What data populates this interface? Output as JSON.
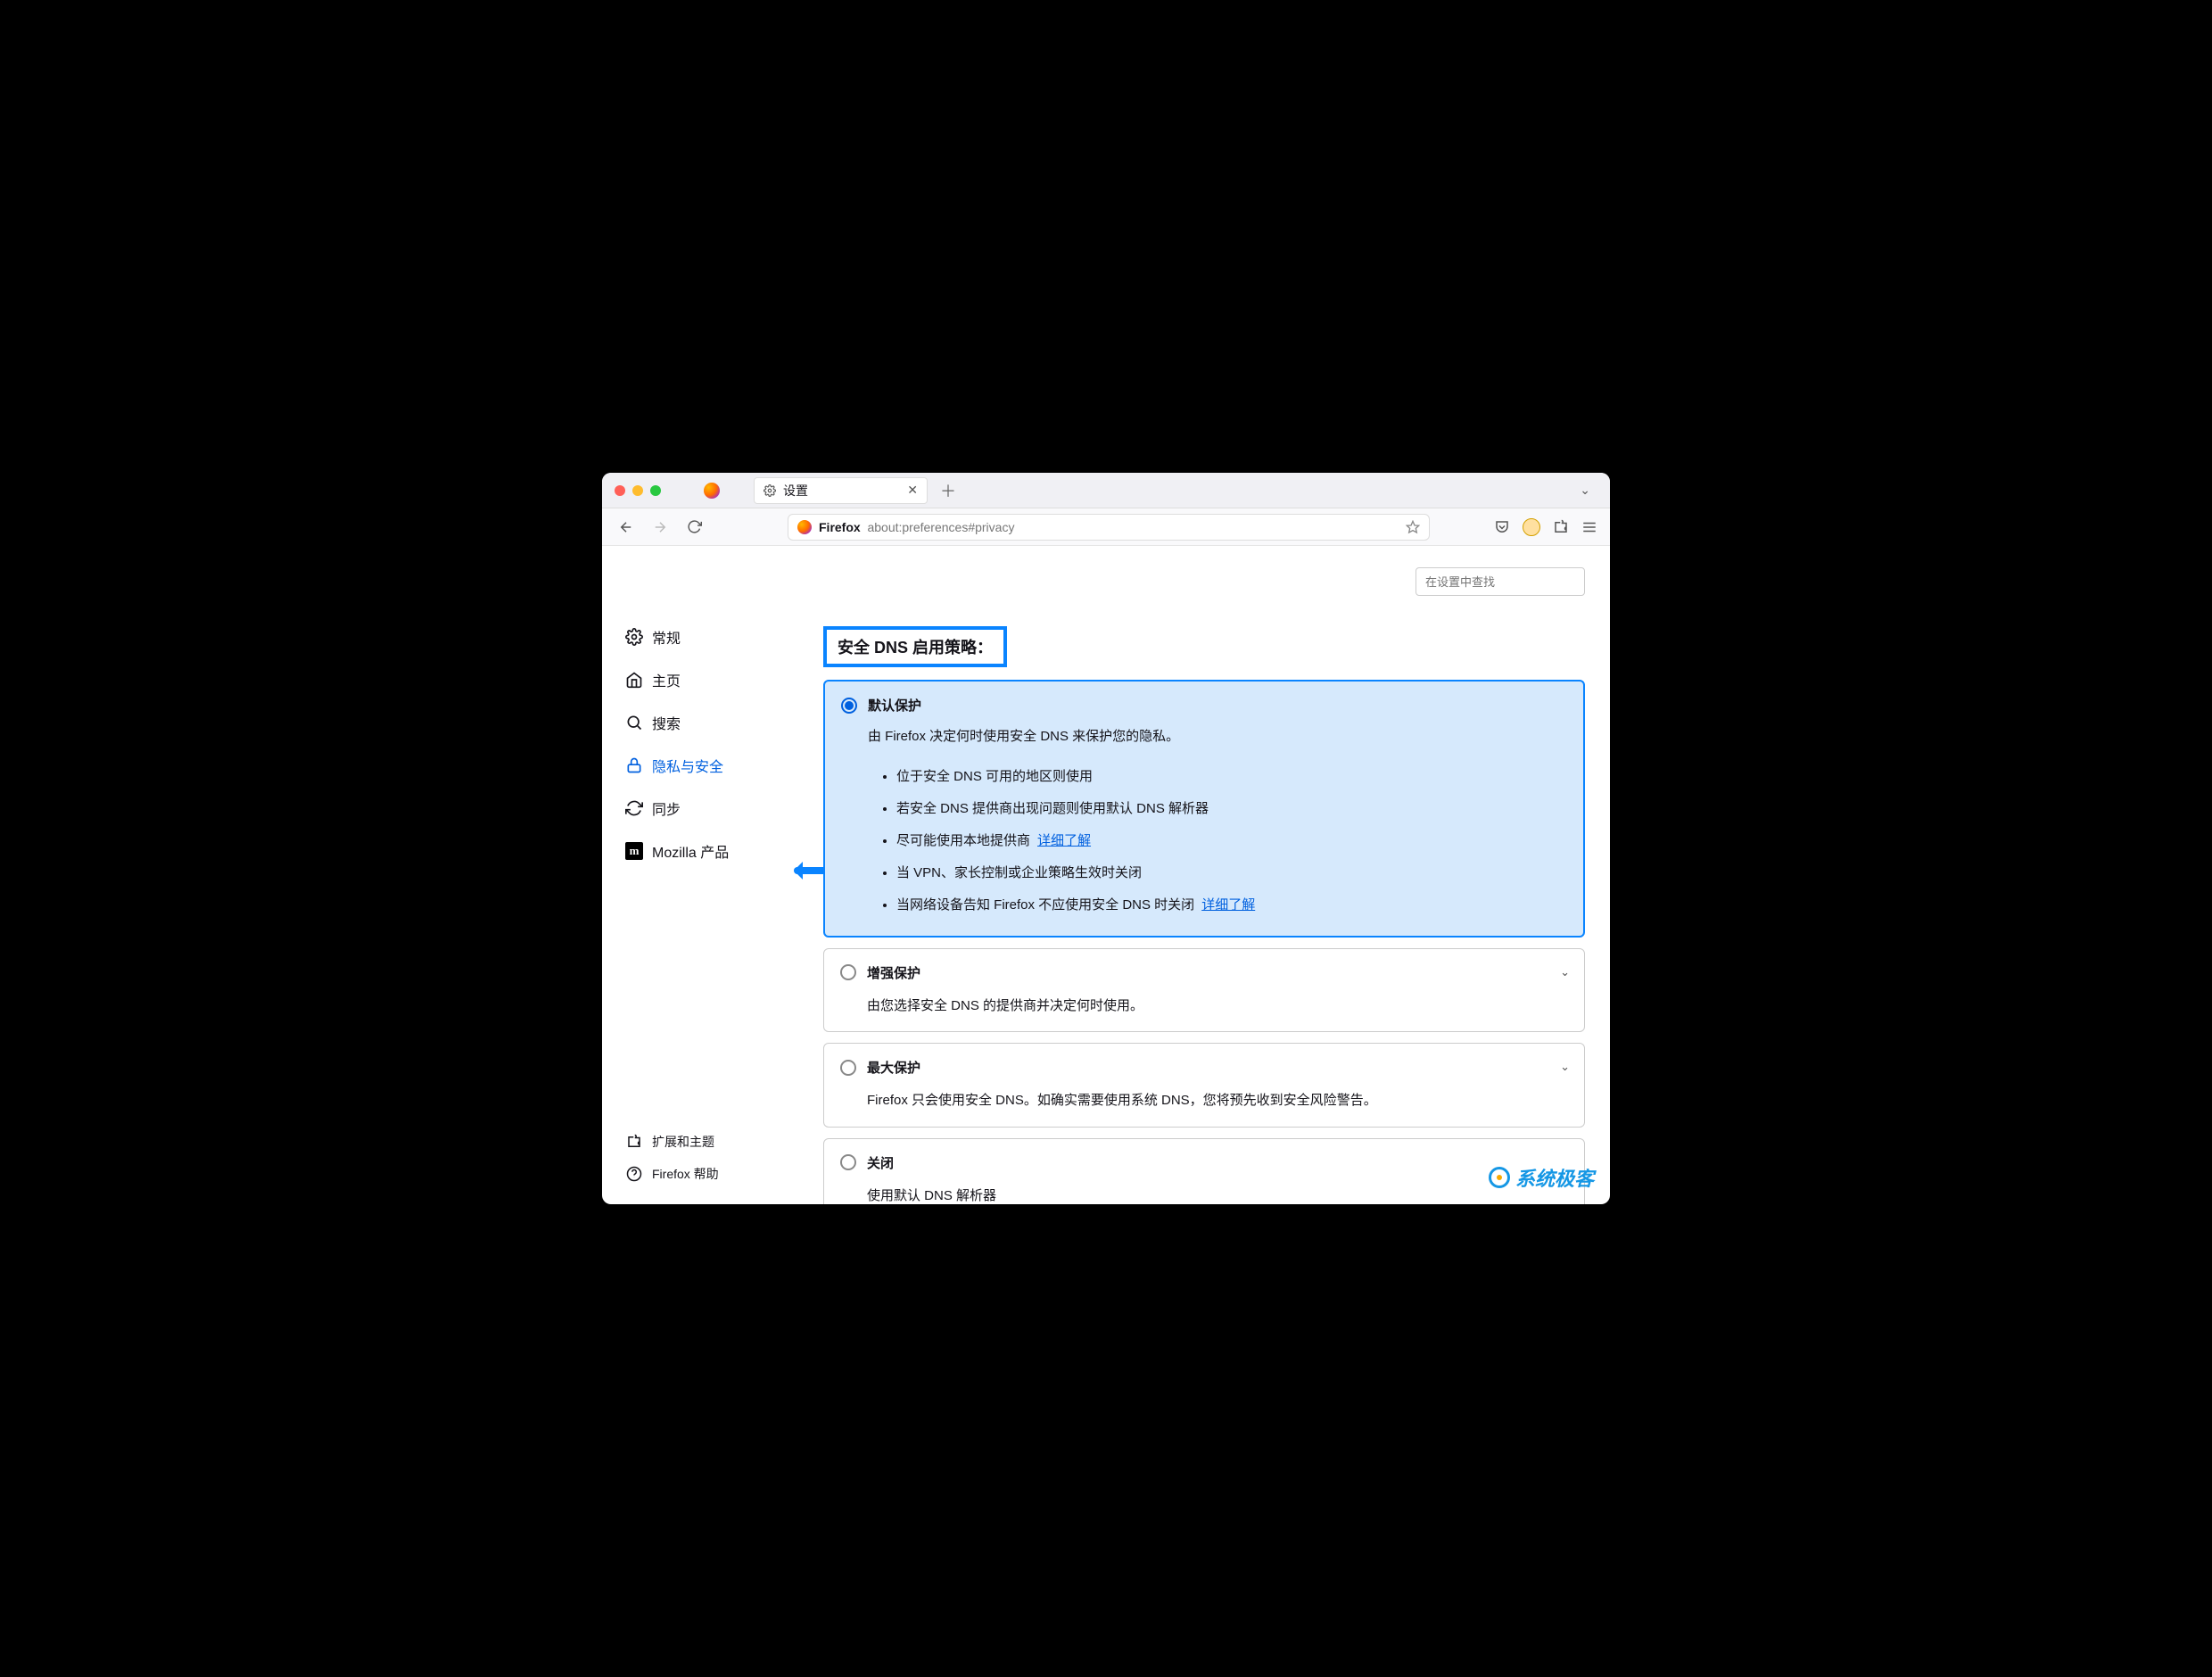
{
  "tab": {
    "title": "设置"
  },
  "urlbar": {
    "label": "Firefox",
    "path": "about:preferences#privacy"
  },
  "search": {
    "placeholder": "在设置中查找"
  },
  "sidebar": {
    "items": [
      {
        "label": "常规"
      },
      {
        "label": "主页"
      },
      {
        "label": "搜索"
      },
      {
        "label": "隐私与安全"
      },
      {
        "label": "同步"
      },
      {
        "label": "Mozilla 产品"
      }
    ],
    "footer": [
      {
        "label": "扩展和主题"
      },
      {
        "label": "Firefox 帮助"
      }
    ]
  },
  "section": {
    "title": "安全 DNS 启用策略："
  },
  "options": {
    "default": {
      "title": "默认保护",
      "desc": "由 Firefox 决定何时使用安全 DNS 来保护您的隐私。",
      "b1": "位于安全 DNS 可用的地区则使用",
      "b2": "若安全 DNS 提供商出现问题则使用默认 DNS 解析器",
      "b3": "尽可能使用本地提供商",
      "b4": "当 VPN、家长控制或企业策略生效时关闭",
      "b5": "当网络设备告知 Firefox 不应使用安全 DNS 时关闭",
      "learn": "详细了解"
    },
    "enhanced": {
      "title": "增强保护",
      "desc": "由您选择安全 DNS 的提供商并决定何时使用。"
    },
    "max": {
      "title": "最大保护",
      "desc": "Firefox 只会使用安全 DNS。如确实需要使用系统 DNS，您将预先收到安全风险警告。"
    },
    "off": {
      "title": "关闭",
      "desc": "使用默认 DNS 解析器"
    }
  },
  "watermark": "系统极客"
}
